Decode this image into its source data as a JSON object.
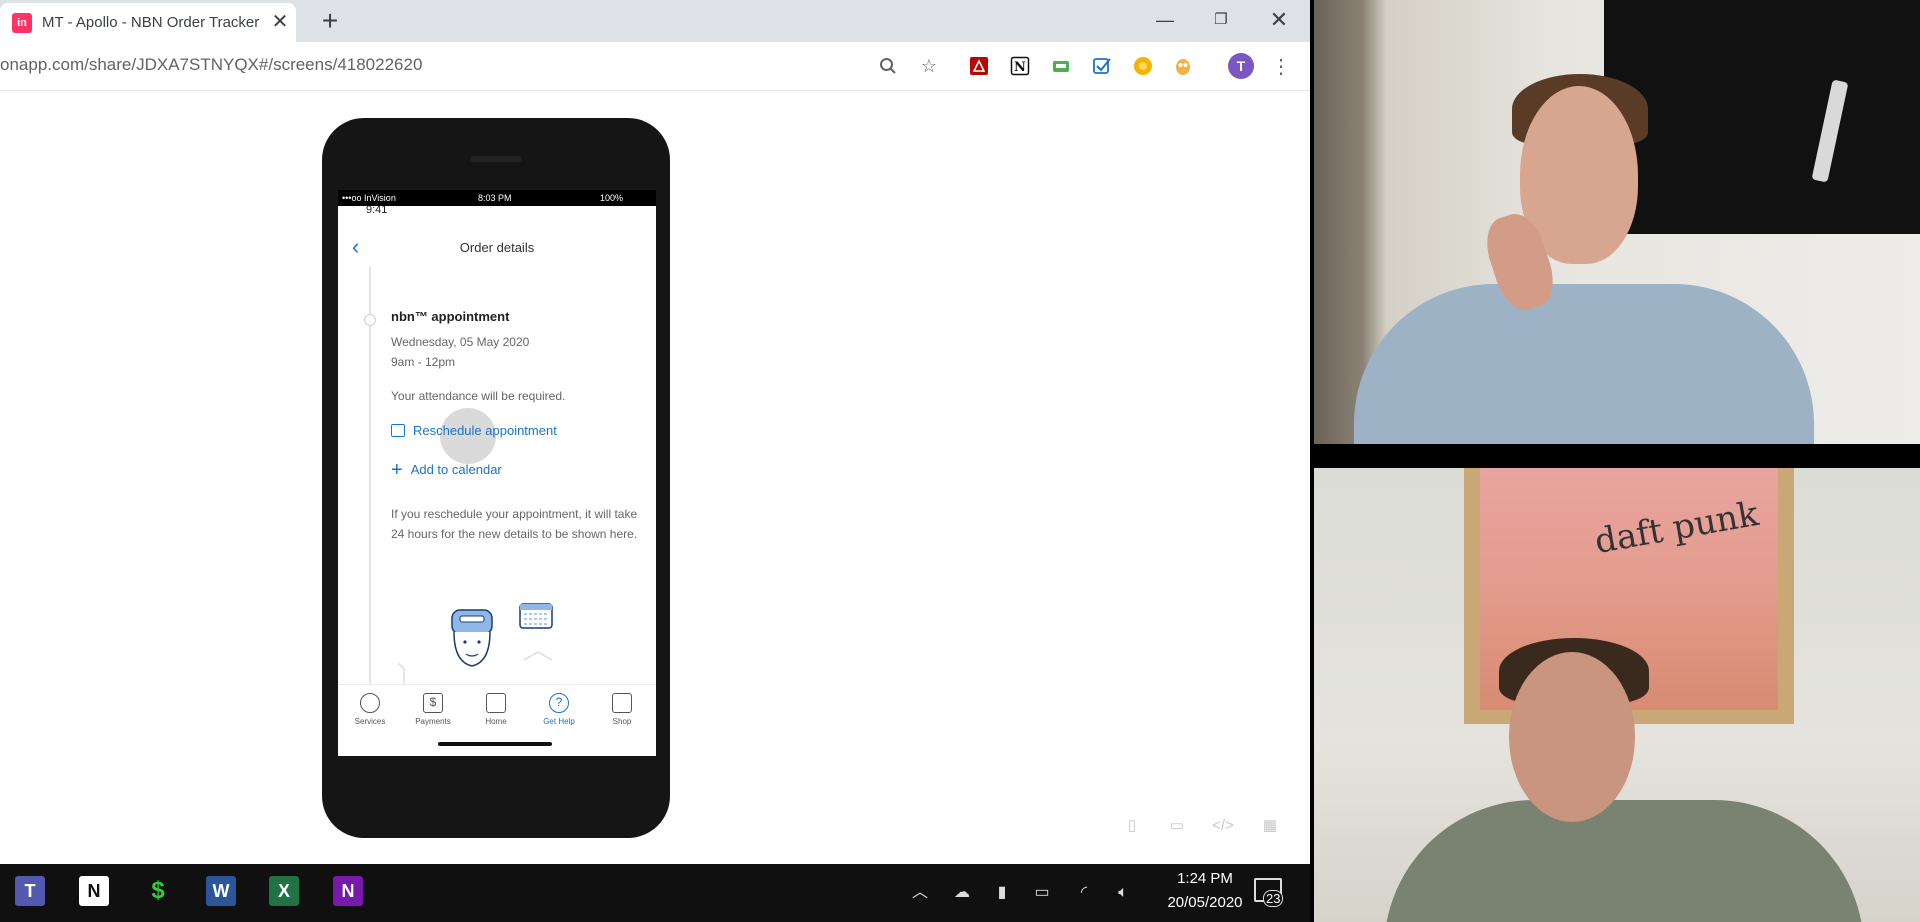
{
  "browser": {
    "tab_favicon": "in",
    "tab_title": "MT - Apollo - NBN Order Tracker",
    "url": "onapp.com/share/JDXA7STNYQX#/screens/418022620",
    "avatar_letter": "T"
  },
  "phone": {
    "status_carrier": "•••oo InVision",
    "status_time": "8:03 PM",
    "status_battery": "100%",
    "ios_time": "9:41",
    "screen_title": "Order details",
    "appointment": {
      "title": "nbn™ appointment",
      "date": "Wednesday, 05 May 2020",
      "time": "9am - 12pm",
      "note": "Your attendance will be required.",
      "reschedule_label": "Reschedule appointment",
      "add_calendar_label": "Add to calendar",
      "info": "If you reschedule your appointment, it will take 24 hours for the new details to be shown here."
    },
    "tabbar": [
      {
        "label": "Services",
        "icon": "services-icon",
        "active": false
      },
      {
        "label": "Payments",
        "icon": "payments-icon",
        "active": false
      },
      {
        "label": "Home",
        "icon": "home-icon",
        "active": false
      },
      {
        "label": "Get Help",
        "icon": "help-icon",
        "active": true
      },
      {
        "label": "Shop",
        "icon": "shop-icon",
        "active": false
      }
    ]
  },
  "taskbar": {
    "clock_time": "1:24 PM",
    "clock_date": "20/05/2020",
    "notification_count": "23"
  },
  "video_bottom": {
    "poster_text": "daft punk"
  },
  "colors": {
    "accent_blue": "#1a73c8",
    "invision_pink": "#ff3366",
    "taskbar_bg": "#101010"
  }
}
